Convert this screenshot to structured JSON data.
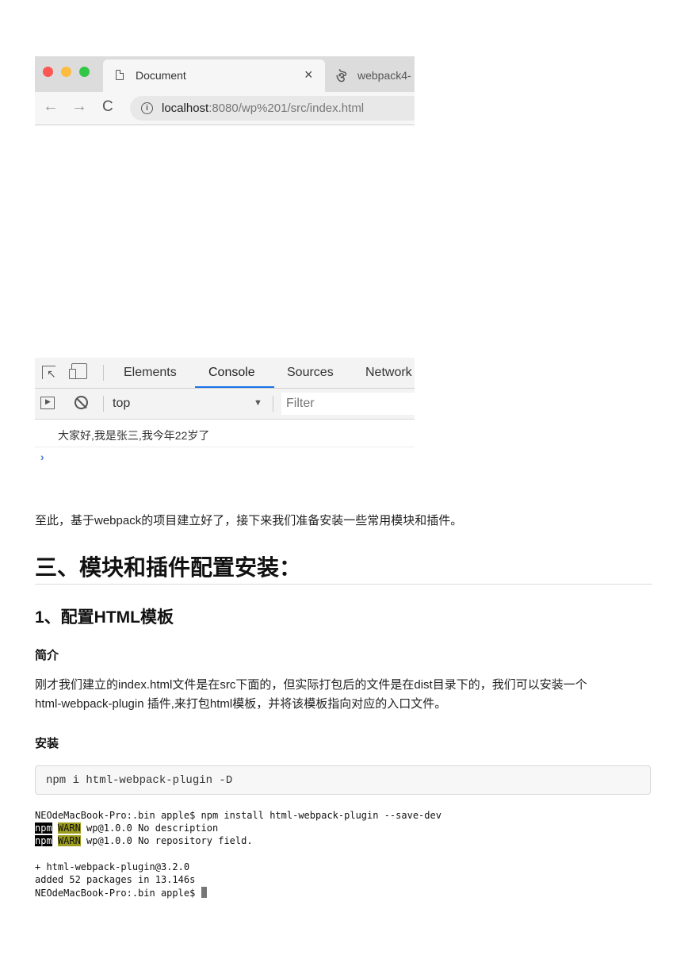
{
  "browser": {
    "active_tab_title": "Document",
    "close_glyph": "×",
    "second_tab_title": "webpack4-",
    "url_host": "localhost",
    "url_rest": ":8080/wp%201/src/index.html",
    "info_glyph": "i"
  },
  "devtools": {
    "tabs": [
      "Elements",
      "Console",
      "Sources",
      "Network"
    ],
    "context": "top",
    "filter_placeholder": "Filter",
    "log_message": "大家好,我是张三,我今年22岁了",
    "prompt_glyph": "›"
  },
  "article": {
    "para1": "至此，基于webpack的项目建立好了，接下来我们准备安装一些常用模块和插件。",
    "h2": "三、模块和插件配置安装：",
    "h3": "1、配置HTML模板",
    "intro_heading": "简介",
    "para2_line1": "刚才我们建立的index.html文件是在src下面的，但实际打包后的文件是在dist目录下的，我们可以安装一个",
    "para2_line2": "html-webpack-plugin 插件,来打包html模板，并将该模板指向对应的入口文件。",
    "install_heading": "安装",
    "code": "npm i html-webpack-plugin -D"
  },
  "terminal": {
    "line1": "NEOdeMacBook-Pro:.bin apple$ npm install html-webpack-plugin --save-dev",
    "npm_tag": "npm",
    "warn_tag": "WARN",
    "warn1": " wp@1.0.0 No description",
    "warn2": " wp@1.0.0 No repository field.",
    "line4": "+ html-webpack-plugin@3.2.0",
    "line5": "added 52 packages in 13.146s",
    "line6": "NEOdeMacBook-Pro:.bin apple$ "
  }
}
